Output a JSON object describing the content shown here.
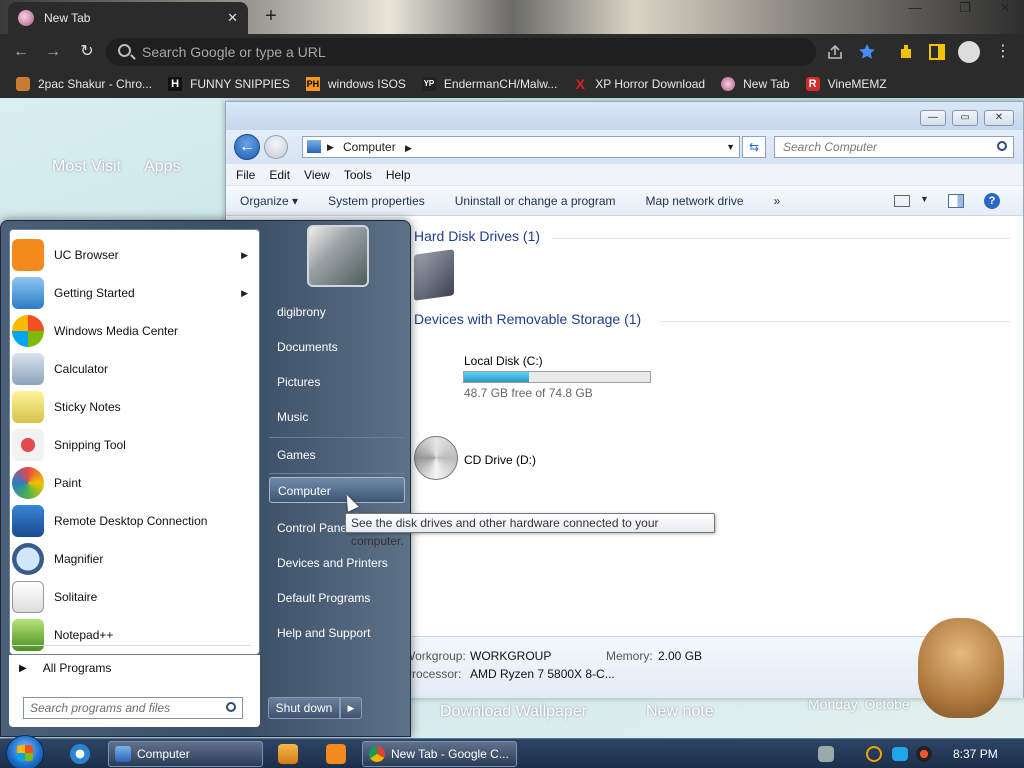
{
  "chrome": {
    "tab_title": "New Tab",
    "tab_close": "✕",
    "new_tab": "+",
    "win_min": "—",
    "win_max": "❐",
    "win_close": "✕",
    "omnibox_placeholder": "Search Google or type a URL",
    "bookmarks": [
      "2pac Shakur - Chro...",
      "FUNNY SNIPPIES",
      "windows ISOS",
      "EndermanCH/Malw...",
      "XP Horror Download",
      "New Tab",
      "VineMEMZ"
    ],
    "bookmark_glyphs": [
      "",
      "H",
      "PH",
      "YP",
      "X",
      "",
      "R"
    ]
  },
  "ntp": {
    "most_visited": "Most Visit",
    "apps": "Apps",
    "download_wallpaper": "Download Wallpaper",
    "new_note": "New note",
    "date": "Monday, Octobe"
  },
  "explorer": {
    "address": "Computer",
    "search_placeholder": "Search Computer",
    "menu": [
      "File",
      "Edit",
      "View",
      "Tools",
      "Help"
    ],
    "commands": [
      "Organize ▾",
      "System properties",
      "Uninstall or change a program",
      "Map network drive",
      "»"
    ],
    "group_hdd": "Hard Disk Drives (1)",
    "group_removable": "Devices with Removable Storage (1)",
    "drive_c_name": "Local Disk (C:)",
    "drive_c_free": "48.7 GB free of 74.8 GB",
    "drive_c_used_fraction": 0.349,
    "cd_name": "CD Drive (D:)",
    "workgroup_label": "Workgroup:",
    "workgroup_value": "WORKGROUP",
    "memory_label": "Memory:",
    "memory_value": "2.00 GB",
    "processor_label": "Processor:",
    "processor_value": "AMD Ryzen 7 5800X 8-C..."
  },
  "startmenu": {
    "programs": [
      "UC Browser",
      "Getting Started",
      "Windows Media Center",
      "Calculator",
      "Sticky Notes",
      "Snipping Tool",
      "Paint",
      "Remote Desktop Connection",
      "Magnifier",
      "Solitaire",
      "Notepad++"
    ],
    "all_programs": "All Programs",
    "search_placeholder": "Search programs and files",
    "right": [
      "digibrony",
      "Documents",
      "Pictures",
      "Music",
      "Games",
      "Computer",
      "Control Panel",
      "Devices and Printers",
      "Default Programs",
      "Help and Support"
    ],
    "shutdown": "Shut down",
    "tooltip": "See the disk drives and other hardware connected to your computer."
  },
  "taskbar": {
    "computer_btn": "Computer",
    "chrome_btn": "New Tab - Google C...",
    "clock": "8:37 PM"
  },
  "colors": {
    "accent": "#1e3d8f",
    "drive_fill": "#2598c8",
    "taskbar": "#1c2f4a"
  }
}
